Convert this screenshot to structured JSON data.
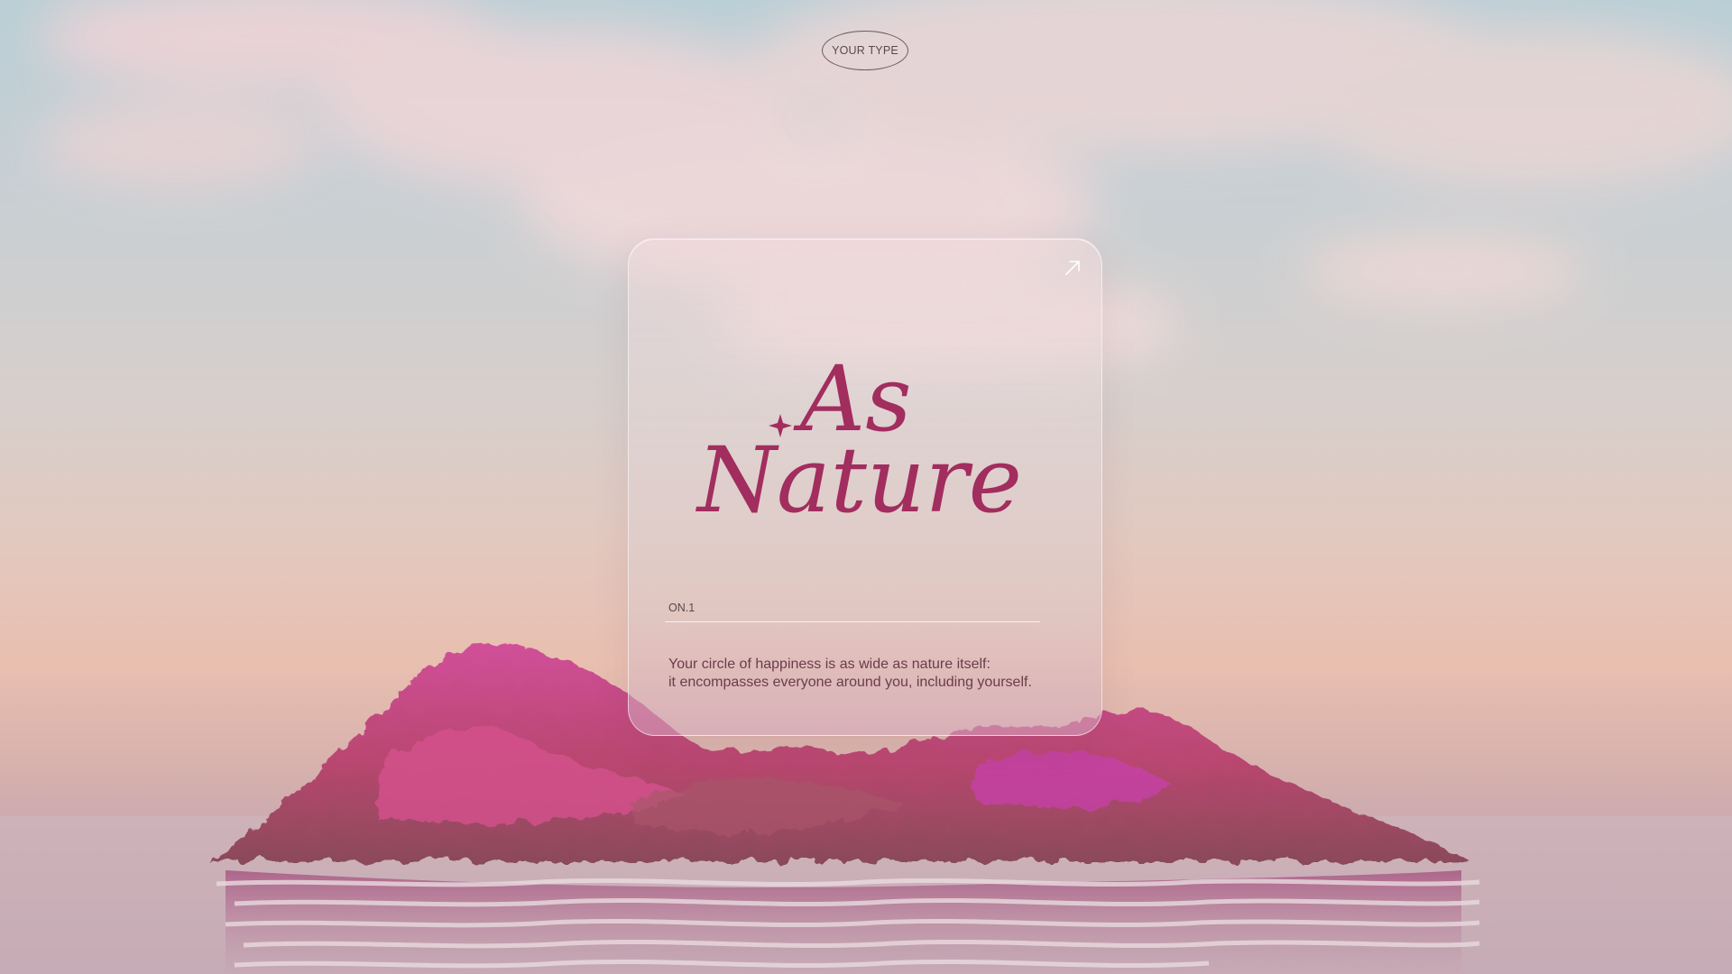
{
  "header": {
    "pill_label": "YOUR TYPE"
  },
  "card": {
    "logo_line1": "As",
    "logo_line2": "Nature",
    "index_label": "ON.1",
    "quote_line1": "Your circle of happiness is as wide as nature itself:",
    "quote_line2": "it encompasses everyone around you, including yourself."
  },
  "colors": {
    "accent": "#a22d5f",
    "text_dark": "#5a4a4c",
    "quote_text": "#6b3d4a",
    "island_pink": "#c9467e",
    "island_magenta": "#b73a9a"
  },
  "icons": {
    "card_link": "arrow-up-right-icon",
    "logo_sparkle": "sparkle-icon"
  }
}
